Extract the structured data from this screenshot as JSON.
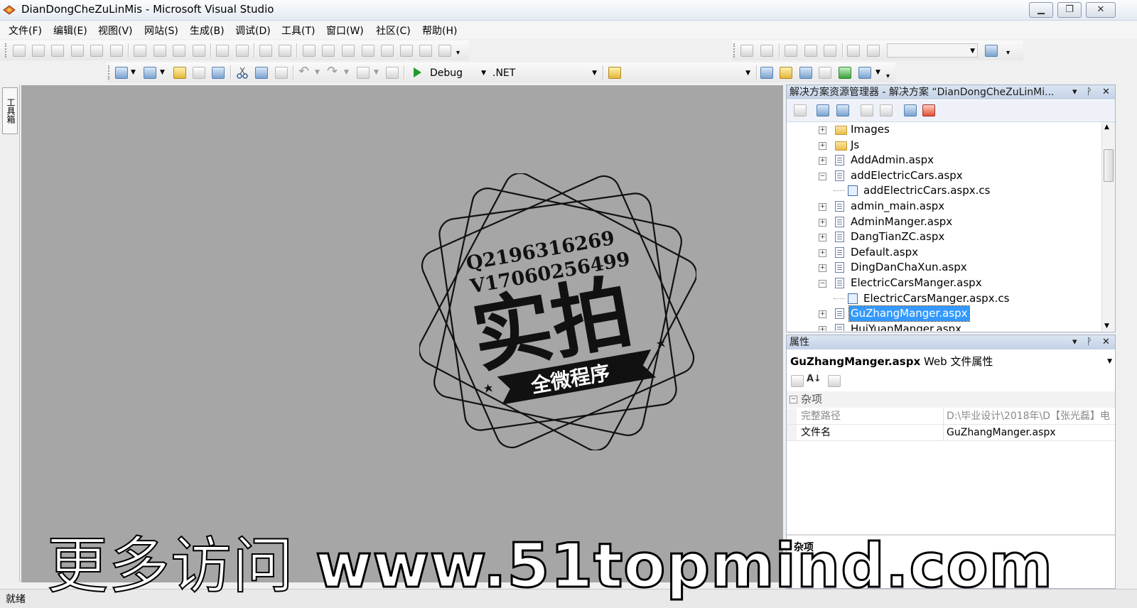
{
  "window": {
    "title": "DianDongCheZuLinMis - Microsoft Visual Studio",
    "minimize": "▁",
    "restore": "❐",
    "close": "✕"
  },
  "menu": [
    "文件(F)",
    "编辑(E)",
    "视图(V)",
    "网站(S)",
    "生成(B)",
    "调试(D)",
    "工具(T)",
    "窗口(W)",
    "社区(C)",
    "帮助(H)"
  ],
  "toolbar": {
    "config": "Debug",
    "platform": ".NET",
    "start_icon": "play-icon"
  },
  "left_strip": {
    "toolbox_label": "工具箱"
  },
  "solution_explorer": {
    "header": "解决方案资源管理器 - 解决方案 “DianDongCheZuLinMi...",
    "pin": "ᚹ",
    "close": "✕",
    "menu": "▾",
    "items": [
      {
        "label": "Images",
        "type": "folder",
        "expander": "+",
        "level": 0
      },
      {
        "label": "Js",
        "type": "folder",
        "expander": "+",
        "level": 0
      },
      {
        "label": "AddAdmin.aspx",
        "type": "page",
        "expander": "+",
        "level": 0
      },
      {
        "label": "addElectricCars.aspx",
        "type": "page",
        "expander": "−",
        "level": 0
      },
      {
        "label": "addElectricCars.aspx.cs",
        "type": "code",
        "expander": "",
        "level": 1
      },
      {
        "label": "admin_main.aspx",
        "type": "page",
        "expander": "+",
        "level": 0
      },
      {
        "label": "AdminManger.aspx",
        "type": "page",
        "expander": "+",
        "level": 0
      },
      {
        "label": "DangTianZC.aspx",
        "type": "page",
        "expander": "+",
        "level": 0
      },
      {
        "label": "Default.aspx",
        "type": "page",
        "expander": "+",
        "level": 0
      },
      {
        "label": "DingDanChaXun.aspx",
        "type": "page",
        "expander": "+",
        "level": 0
      },
      {
        "label": "ElectricCarsManger.aspx",
        "type": "page",
        "expander": "−",
        "level": 0
      },
      {
        "label": "ElectricCarsManger.aspx.cs",
        "type": "code",
        "expander": "",
        "level": 1
      },
      {
        "label": "GuZhangManger.aspx",
        "type": "page",
        "expander": "+",
        "level": 0,
        "selected": true
      },
      {
        "label": "HuiYuanManger.aspx",
        "type": "page",
        "expander": "+",
        "level": 0
      }
    ]
  },
  "properties": {
    "header": "属性",
    "object_name": "GuZhangManger.aspx",
    "object_type": "Web 文件属性",
    "category": "杂项",
    "rows": [
      {
        "name": "完整路径",
        "value": "D:\\毕业设计\\2018年\\D【张光磊】电"
      },
      {
        "name": "文件名",
        "value": "GuZhangManger.aspx"
      }
    ],
    "description_title": "杂项"
  },
  "stamp": {
    "qq": "Q2196316269",
    "wechat": "V17060256499",
    "big_text": "实拍",
    "ribbon_text": "全微程序"
  },
  "banner": {
    "prefix": "更多访问",
    "url": "www.51topmind.com"
  },
  "status": {
    "text": "就绪"
  }
}
